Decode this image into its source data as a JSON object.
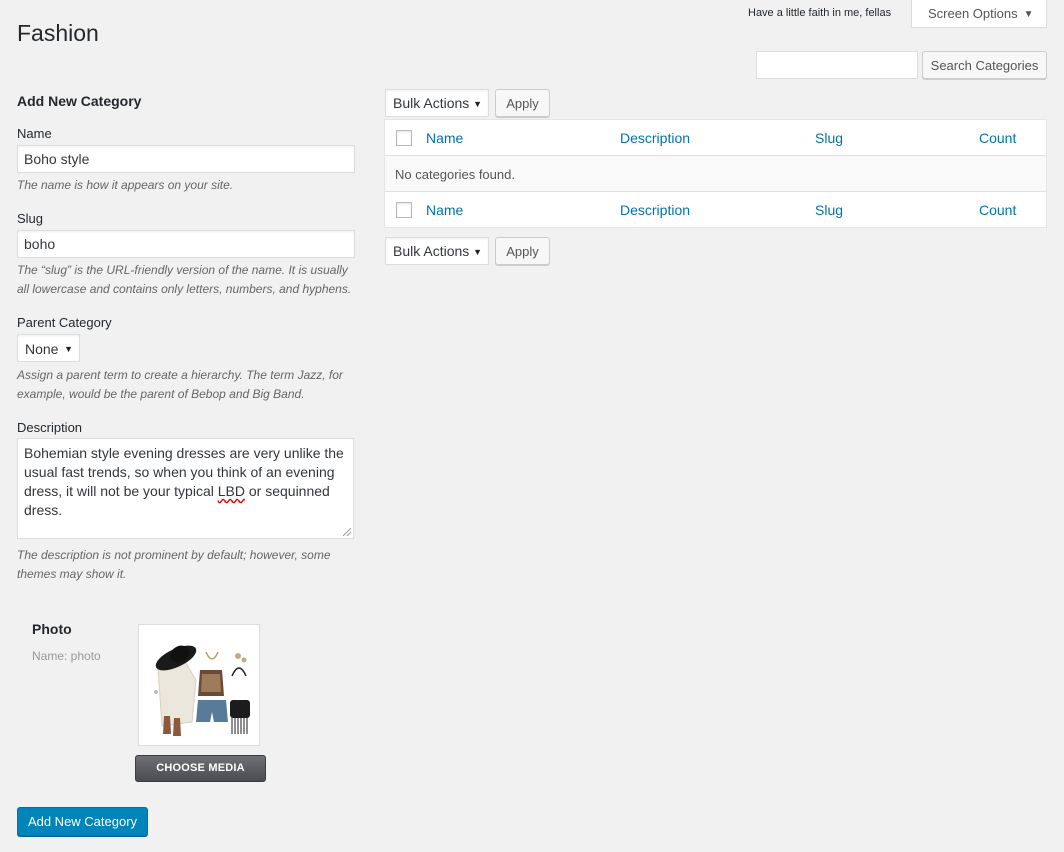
{
  "header": {
    "tagline": "Have a little faith in me, fellas",
    "screen_options_label": "Screen Options",
    "page_title": "Fashion"
  },
  "search": {
    "value": "",
    "button_label": "Search Categories"
  },
  "form": {
    "heading": "Add New Category",
    "name": {
      "label": "Name",
      "value": "Boho style",
      "help": "The name is how it appears on your site."
    },
    "slug": {
      "label": "Slug",
      "value": "boho",
      "help_line1": "The “slug” is the URL-friendly version of the name. It is usually",
      "help_line2": "all lowercase and contains only letters, numbers, and hyphens."
    },
    "parent": {
      "label": "Parent Category",
      "selected": "None",
      "help_line1": "Assign a parent term to create a hierarchy. The term Jazz, for",
      "help_line2": "example, would be the parent of Bebop and Big Band."
    },
    "description": {
      "label": "Description",
      "line1": "Bohemian style evening dresses are very unlike the",
      "line2": "usual fast trends, so when you think of an evening",
      "line3_before": "dress, it will not be your typical ",
      "line3_misspelled": "LBD",
      "line3_after": " or sequinned",
      "line4": "dress.",
      "help_line1": "The description is not prominent by default; however, some",
      "help_line2": "themes may show it."
    },
    "photo": {
      "title": "Photo",
      "subtitle": "Name: photo",
      "choose_media_label": "CHOOSE MEDIA"
    },
    "submit_label": "Add New Category"
  },
  "table": {
    "bulk_actions_label": "Bulk Actions",
    "apply_label": "Apply",
    "columns": [
      "Name",
      "Description",
      "Slug",
      "Count"
    ],
    "empty_message": "No categories found."
  },
  "colors": {
    "link": "#0073aa",
    "primary_button": "#0085ba",
    "background": "#f1f1f1"
  }
}
